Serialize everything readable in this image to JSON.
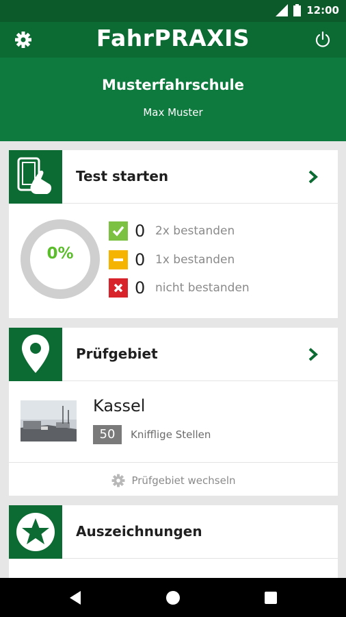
{
  "status_bar": {
    "time": "12:00"
  },
  "app_bar": {
    "title": "FahrPRAXIS",
    "settings_icon": "gear-icon",
    "power_icon": "power-icon"
  },
  "header": {
    "school": "Musterfahrschule",
    "user": "Max Muster"
  },
  "test_card": {
    "title": "Test starten",
    "icon": "tablet-hand-icon",
    "progress_label": "0%",
    "progress": 0,
    "results": [
      {
        "count": "0",
        "label": "2x bestanden",
        "color": "#7cc142",
        "icon": "check-icon"
      },
      {
        "count": "0",
        "label": "1x bestanden",
        "color": "#f5b400",
        "icon": "minus-icon"
      },
      {
        "count": "0",
        "label": "nicht bestanden",
        "color": "#d8232a",
        "icon": "x-icon"
      }
    ]
  },
  "area_card": {
    "title": "Prüfgebiet",
    "icon": "map-pin-icon",
    "city": "Kassel",
    "count": "50",
    "count_label": "Knifflige Stellen",
    "change_label": "Prüfgebiet wechseln"
  },
  "awards_card": {
    "title": "Auszeichnungen",
    "icon": "star-badge-icon"
  },
  "colors": {
    "primary": "#0c6a33",
    "header": "#0e7a3d",
    "accent_green": "#5bbd2b"
  }
}
